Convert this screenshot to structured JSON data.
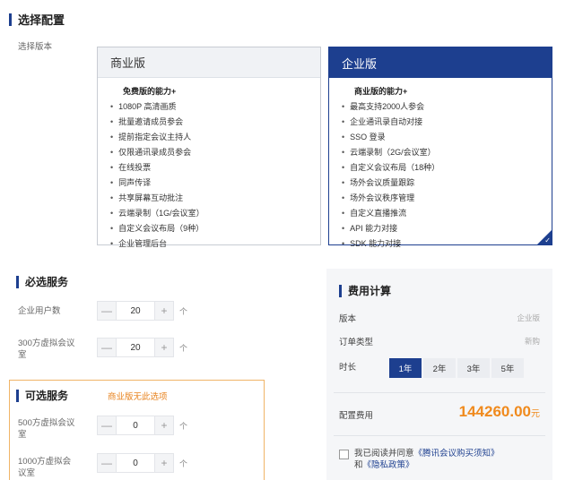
{
  "config": {
    "title": "选择配置",
    "version_label": "选择版本",
    "plans": [
      {
        "name": "商业版",
        "cap_title": "免费版的能力+",
        "features": [
          "1080P 高清画质",
          "批量邀请成员参会",
          "提前指定会议主持人",
          "仅限通讯录成员参会",
          "在线投票",
          "同声传译",
          "共享屏幕互动批注",
          "云端录制（1G/会议室）",
          "自定义会议布局（9种）",
          "企业管理后台"
        ]
      },
      {
        "name": "企业版",
        "cap_title": "商业版的能力+",
        "features": [
          "最高支持2000人参会",
          "企业通讯录自动对接",
          "SSO 登录",
          "云端录制（2G/会议室）",
          "自定义会议布局（18种）",
          "场外会议质量跟踪",
          "场外会议秩序管理",
          "自定义直播推流",
          "API 能力对接",
          "SDK 能力对接"
        ],
        "check_mark": "✓"
      }
    ]
  },
  "required": {
    "title": "必选服务",
    "items": [
      {
        "label": "企业用户数",
        "minus": "—",
        "value": "20",
        "plus": "+",
        "unit": "个"
      },
      {
        "label": "300方虚拟会议室",
        "minus": "—",
        "value": "20",
        "plus": "+",
        "unit": "个"
      }
    ]
  },
  "optional": {
    "title": "可选服务",
    "warning": "商业版无此选项",
    "items": [
      {
        "label": "500方虚拟会议室",
        "minus": "—",
        "value": "0",
        "plus": "+",
        "unit": "个"
      },
      {
        "label": "1000方虚拟会议室",
        "minus": "—",
        "value": "0",
        "plus": "+",
        "unit": "个"
      }
    ]
  },
  "fee": {
    "title": "费用计算",
    "version_label": "版本",
    "version_value": "企业版",
    "order_type_label": "订单类型",
    "order_type_value": "新购",
    "duration_label": "时长",
    "durations": [
      "1年",
      "2年",
      "3年",
      "5年"
    ],
    "selected_duration": "1年",
    "cost_label": "配置费用",
    "cost_value": "144260.00",
    "cost_unit": "元",
    "agree_prefix": "我已阅读并同意",
    "agree_link1": "《腾讯会议购买须知》",
    "agree_and": "和",
    "agree_link2": "《隐私政策》"
  },
  "colors": {
    "primary": "#1d3f8f",
    "accent": "#f08a1d",
    "warning_border": "#f0b467"
  }
}
